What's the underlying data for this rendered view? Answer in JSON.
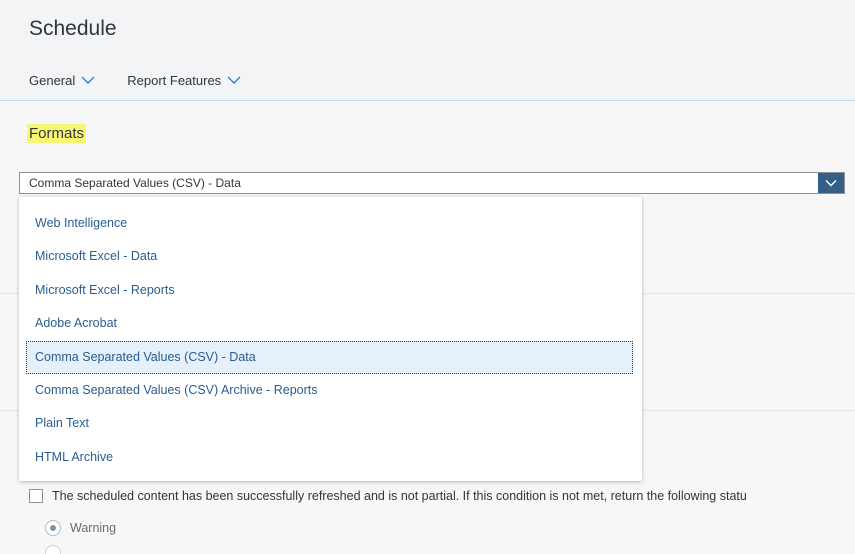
{
  "header": {
    "title": "Schedule",
    "tabs": [
      {
        "label": "General"
      },
      {
        "label": "Report Features"
      }
    ]
  },
  "formats": {
    "section_title": "Formats",
    "selected_value": "Comma Separated Values (CSV) - Data",
    "options": [
      "Web Intelligence",
      "Microsoft Excel - Data",
      "Microsoft Excel - Reports",
      "Adobe Acrobat",
      "Comma Separated Values (CSV) - Data",
      "Comma Separated Values (CSV) Archive - Reports",
      "Plain Text",
      "HTML Archive"
    ]
  },
  "condition": {
    "checkbox_label": "The scheduled content has been successfully refreshed and is not partial. If this condition is not met, return the following statu",
    "radio_label": "Warning"
  },
  "colors": {
    "accent": "#345f86",
    "link": "#2a5d8f",
    "highlight": "#f7f774"
  }
}
